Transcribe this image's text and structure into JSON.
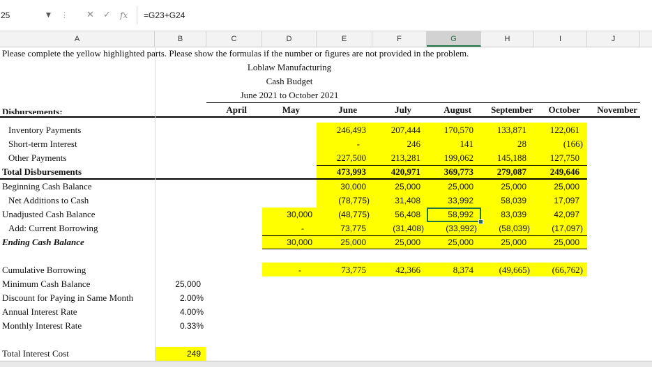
{
  "formula_bar": {
    "name_box": "25",
    "formula": "=G23+G24",
    "icons": [
      "chevron-down-icon",
      "more-options-icon",
      "cancel-icon",
      "enter-icon",
      "function-icon"
    ],
    "cancel_glyph": "✕",
    "enter_glyph": "✓",
    "fx_glyph": "fx",
    "dots_glyph": "⋮",
    "arrow_glyph": "▼"
  },
  "columns": [
    "A",
    "B",
    "C",
    "D",
    "E",
    "F",
    "G",
    "H",
    "I",
    "J"
  ],
  "selected_column": "G",
  "sheet": {
    "instruction": "Please complete the yellow highlighted parts. Please show the formulas if the number or figures are not provided in the problem.",
    "company": "Loblaw Manufacturing",
    "report": "Cash Budget",
    "period": "June 2021 to October 2021",
    "month_headers": [
      "April",
      "May",
      "June",
      "July",
      "August",
      "September",
      "October",
      "November"
    ],
    "partial_label": "Disbursements:",
    "inventory": {
      "label": "Inventory Payments",
      "values": [
        "246,493",
        "207,444",
        "170,570",
        "133,871",
        "122,061"
      ]
    },
    "interest": {
      "label": "Short-term Interest",
      "values": [
        "-",
        "246",
        "141",
        "28",
        "(166)"
      ]
    },
    "other": {
      "label": "Other Payments",
      "values": [
        "227,500",
        "213,281",
        "199,062",
        "145,188",
        "127,750"
      ]
    },
    "total_disb": {
      "label": "Total Disbursements",
      "values": [
        "473,993",
        "420,971",
        "369,773",
        "279,087",
        "249,646"
      ]
    },
    "beginning": {
      "label": "Beginning Cash Balance",
      "values": [
        "30,000",
        "25,000",
        "25,000",
        "25,000",
        "25,000"
      ]
    },
    "net_add": {
      "label": "Net Additions to Cash",
      "values": [
        "(78,775)",
        "31,408",
        "33,992",
        "58,039",
        "17,097"
      ]
    },
    "unadjusted": {
      "label": "Unadjusted Cash Balance",
      "may": "30,000",
      "values": [
        "(48,775)",
        "56,408",
        "58,992",
        "83,039",
        "42,097"
      ]
    },
    "borrowing": {
      "label": "Add: Current Borrowing",
      "may": "-",
      "values": [
        "73,775",
        "(31,408)",
        "(33,992)",
        "(58,039)",
        "(17,097)"
      ]
    },
    "ending": {
      "label": "Ending Cash Balance",
      "may": "30,000",
      "values": [
        "25,000",
        "25,000",
        "25,000",
        "25,000",
        "25,000"
      ]
    },
    "cumulative": {
      "label": "Cumulative Borrowing",
      "may": "-",
      "values": [
        "73,775",
        "42,366",
        "8,374",
        "(49,665)",
        "(66,762)"
      ]
    },
    "min_cash": {
      "label": "Minimum Cash Balance",
      "value": "25,000"
    },
    "discount": {
      "label": "Discount for Paying in Same Month",
      "value": "2.00%"
    },
    "annual_rate": {
      "label": "Annual Interest Rate",
      "value": "4.00%"
    },
    "monthly_rate": {
      "label": "Monthly Interest Rate",
      "value": "0.33%"
    },
    "total_interest": {
      "label": "Total Interest Cost",
      "value": "249"
    }
  },
  "colors": {
    "highlight": "#ffff00",
    "selection": "#217346"
  }
}
